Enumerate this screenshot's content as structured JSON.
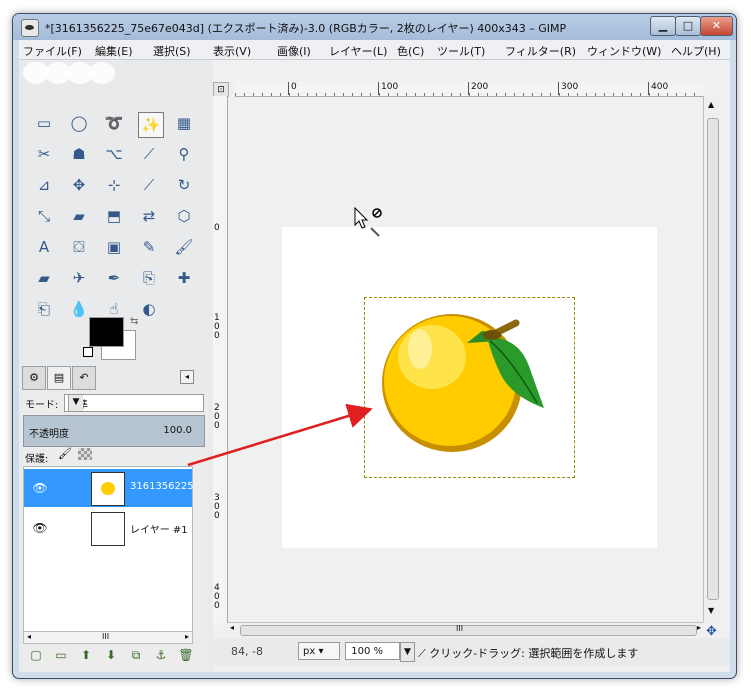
{
  "window": {
    "title": "*[3161356225_75e67e043d] (エクスポート済み)-3.0 (RGBカラー, 2枚のレイヤー) 400x343 – GIMP",
    "min_symbol": "▁",
    "max_symbol": "□",
    "close_symbol": "✕"
  },
  "menu": [
    "ファイル(F)",
    "編集(E)",
    "選択(S)",
    "表示(V)",
    "画像(I)",
    "レイヤー(L)",
    "色(C)",
    "ツール(T)",
    "フィルター(R)",
    "ウィンドウ(W)",
    "ヘルプ(H)"
  ],
  "toolbox": {
    "tools": [
      {
        "name": "rect-select-icon",
        "glyph": "▭"
      },
      {
        "name": "ellipse-select-icon",
        "glyph": "◯"
      },
      {
        "name": "free-select-icon",
        "glyph": "➰"
      },
      {
        "name": "fuzzy-select-icon",
        "glyph": "✨"
      },
      {
        "name": "color-select-icon",
        "glyph": "▦"
      },
      {
        "name": "scissors-select-icon",
        "glyph": "✂"
      },
      {
        "name": "foreground-select-icon",
        "glyph": "☗"
      },
      {
        "name": "paths-icon",
        "glyph": "⌥"
      },
      {
        "name": "color-picker-icon",
        "glyph": "⟋"
      },
      {
        "name": "zoom-icon",
        "glyph": "⚲"
      },
      {
        "name": "measure-icon",
        "glyph": "⊿"
      },
      {
        "name": "move-icon",
        "glyph": "✥"
      },
      {
        "name": "align-icon",
        "glyph": "⊹"
      },
      {
        "name": "crop-icon",
        "glyph": "⟋"
      },
      {
        "name": "rotate-icon",
        "glyph": "↻"
      },
      {
        "name": "scale-icon",
        "glyph": "⤡"
      },
      {
        "name": "shear-icon",
        "glyph": "▰"
      },
      {
        "name": "perspective-icon",
        "glyph": "⬒"
      },
      {
        "name": "flip-icon",
        "glyph": "⇄"
      },
      {
        "name": "cage-transform-icon",
        "glyph": "⬡"
      },
      {
        "name": "text-icon",
        "glyph": "A"
      },
      {
        "name": "bucket-fill-icon",
        "glyph": "⛋"
      },
      {
        "name": "blend-icon",
        "glyph": "▣"
      },
      {
        "name": "pencil-icon",
        "glyph": "✎"
      },
      {
        "name": "paintbrush-icon",
        "glyph": "🖌"
      },
      {
        "name": "eraser-icon",
        "glyph": "▰"
      },
      {
        "name": "airbrush-icon",
        "glyph": "✈"
      },
      {
        "name": "ink-icon",
        "glyph": "✒"
      },
      {
        "name": "clone-icon",
        "glyph": "⎘"
      },
      {
        "name": "heal-icon",
        "glyph": "✚"
      },
      {
        "name": "perspective-clone-icon",
        "glyph": "⎗"
      },
      {
        "name": "blur-icon",
        "glyph": "💧"
      },
      {
        "name": "smudge-icon",
        "glyph": "☝"
      },
      {
        "name": "dodge-burn-icon",
        "glyph": "◐"
      }
    ],
    "active_tool_index": 3
  },
  "dock": {
    "tab_icons": [
      "tool-options-icon",
      "layers-icon",
      "undo-history-icon"
    ],
    "tab_glyphs": [
      "⚙",
      "▤",
      "↶"
    ],
    "tab_menu_glyph": "◂",
    "mode_label": "モード:",
    "mode_value": "標準",
    "opacity_label": "不透明度",
    "opacity_value": "100.0",
    "lock_label": "保護:",
    "layers": [
      {
        "name": "3161356225",
        "selected": true,
        "visible": true
      },
      {
        "name": "レイヤー #1",
        "selected": false,
        "visible": true
      }
    ],
    "scroll_glyph": "III",
    "buttons": [
      {
        "name": "new-layer-icon",
        "glyph": "▢"
      },
      {
        "name": "new-layer-group-icon",
        "glyph": "▭"
      },
      {
        "name": "raise-layer-icon",
        "glyph": "⬆"
      },
      {
        "name": "lower-layer-icon",
        "glyph": "⬇"
      },
      {
        "name": "duplicate-layer-icon",
        "glyph": "⧉"
      },
      {
        "name": "anchor-layer-icon",
        "glyph": "⚓"
      },
      {
        "name": "delete-layer-icon",
        "glyph": "🗑"
      }
    ]
  },
  "canvas": {
    "ruler_h_labels": [
      "0",
      "100",
      "200",
      "300",
      "400"
    ],
    "ruler_v_labels": [
      "0",
      "100",
      "200",
      "300",
      "400"
    ],
    "scroll_glyph": "III"
  },
  "status": {
    "coords": "84, -8",
    "unit": "px",
    "zoom": "100 %",
    "message": "クリック-ドラッグ: 選択範囲を作成します"
  },
  "colors": {
    "accent": "#3399ff",
    "fruit": "#ffcc00",
    "leaf": "#2a9a2a",
    "arrow": "#e02020"
  }
}
